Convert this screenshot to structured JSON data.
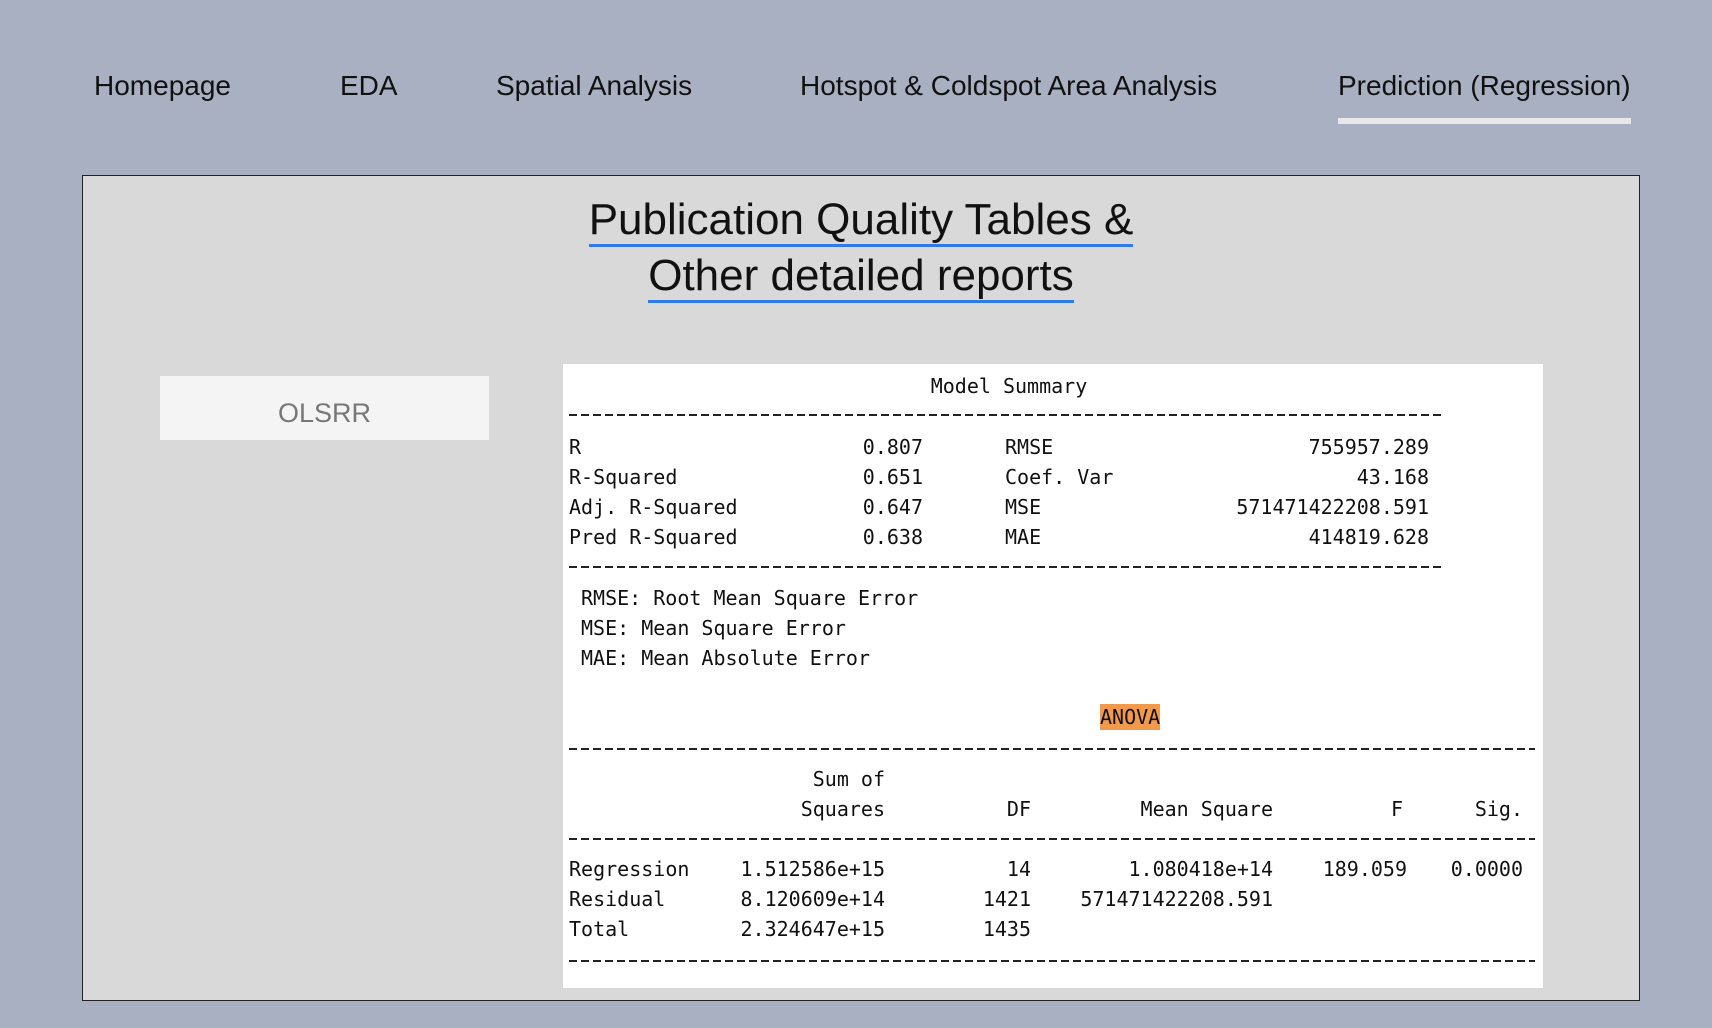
{
  "nav": {
    "items": [
      "Homepage",
      "EDA",
      "Spatial Analysis",
      "Hotspot & Coldspot Area Analysis",
      "Prediction (Regression)"
    ],
    "active": "Prediction (Regression)"
  },
  "page": {
    "title_line1": "Publication Quality Tables & ",
    "title_line2": "Other detailed reports",
    "olsrr_button": "OLSRR"
  },
  "model_summary": {
    "title": "Model Summary",
    "rows": [
      {
        "label": "R",
        "value": "0.807",
        "label2": "RMSE",
        "value2": "755957.289"
      },
      {
        "label": "R-Squared",
        "value": "0.651",
        "label2": "Coef. Var",
        "value2": "43.168"
      },
      {
        "label": "Adj. R-Squared",
        "value": "0.647",
        "label2": "MSE",
        "value2": "571471422208.591"
      },
      {
        "label": "Pred R-Squared",
        "value": "0.638",
        "label2": "MAE",
        "value2": "414819.628"
      }
    ],
    "notes": [
      "RMSE: Root Mean Square Error",
      "MSE: Mean Square Error",
      "MAE: Mean Absolute Error"
    ]
  },
  "anova": {
    "title": "ANOVA",
    "highlight_color": "#f29a4c",
    "headers": {
      "ss_top": "Sum of",
      "ss": "Squares",
      "df": "DF",
      "ms": "Mean Square",
      "f": "F",
      "sig": "Sig."
    },
    "rows": [
      {
        "label": "Regression",
        "ss": "1.512586e+15",
        "df": "14",
        "ms": "1.080418e+14",
        "f": "189.059",
        "sig": "0.0000"
      },
      {
        "label": "Residual",
        "ss": "8.120609e+14",
        "df": "1421",
        "ms": "571471422208.591",
        "f": "",
        "sig": ""
      },
      {
        "label": "Total",
        "ss": "2.324647e+15",
        "df": "1435",
        "ms": "",
        "f": "",
        "sig": ""
      }
    ]
  }
}
